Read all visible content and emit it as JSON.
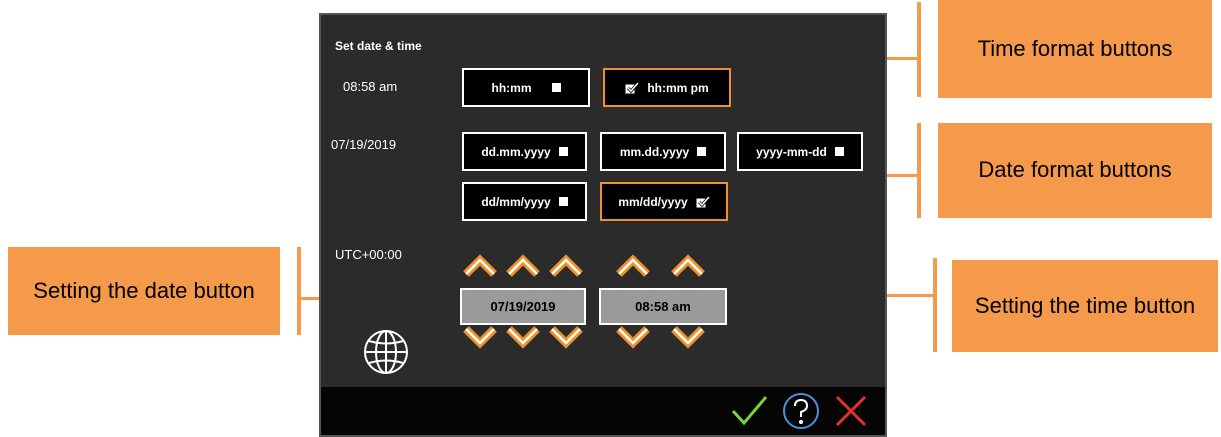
{
  "dialog": {
    "title": "Set date & time",
    "time_value": "08:58 am",
    "date_value": "07/19/2019",
    "timezone": "UTC+00:00"
  },
  "time_formats": [
    {
      "label": "hh:mm",
      "selected": false
    },
    {
      "label": "hh:mm pm",
      "selected": true
    }
  ],
  "date_formats": [
    {
      "label": "dd.mm.yyyy",
      "selected": false
    },
    {
      "label": "mm.dd.yyyy",
      "selected": false
    },
    {
      "label": "yyyy-mm-dd",
      "selected": false
    },
    {
      "label": "dd/mm/yyyy",
      "selected": false
    },
    {
      "label": "mm/dd/yyyy",
      "selected": true
    }
  ],
  "setters": {
    "date_button": "07/19/2019",
    "time_button": "08:58 am"
  },
  "callouts": {
    "time_format": "Time format buttons",
    "date_format": "Date format buttons",
    "set_date": "Setting the date button",
    "set_time": "Setting the time button"
  },
  "icons": {
    "globe": "globe-icon",
    "confirm": "checkmark-icon",
    "help": "help-icon",
    "cancel": "close-icon"
  },
  "colors": {
    "accent": "#f0902a",
    "callout": "#f5994a",
    "panel": "#2b2b2b",
    "confirm": "#7bd33a",
    "help": "#4a8fe0",
    "cancel": "#e23030"
  }
}
